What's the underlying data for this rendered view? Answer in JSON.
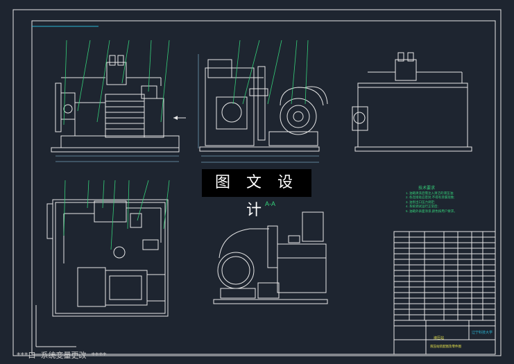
{
  "overlay": {
    "watermark_text": "图 文 设 计",
    "section_label": "A-A"
  },
  "status_bar": {
    "command_text": "***口  系统变量更改  ****"
  },
  "notes": {
    "title": "技术要求",
    "lines": [
      "1. 油箱清洗后需注入清洁的液压油;",
      "2. 各连接处应密封,不得有渗漏现象;",
      "3. 油泵出口压力调定;",
      "4. 系统调试运行正常后;",
      "5. 油箱外表面涂漆,颜色按用户要求。"
    ]
  },
  "title_block": {
    "university": "辽宁科技大学",
    "name": "液压站",
    "drawing_title": "液压站装配图及零件图"
  },
  "colors": {
    "background": "#1e2530",
    "frame": "#e8e8e8",
    "leader": "#35d07a",
    "part": "#2ab7d6",
    "text_yellow": "#e7e34a"
  }
}
